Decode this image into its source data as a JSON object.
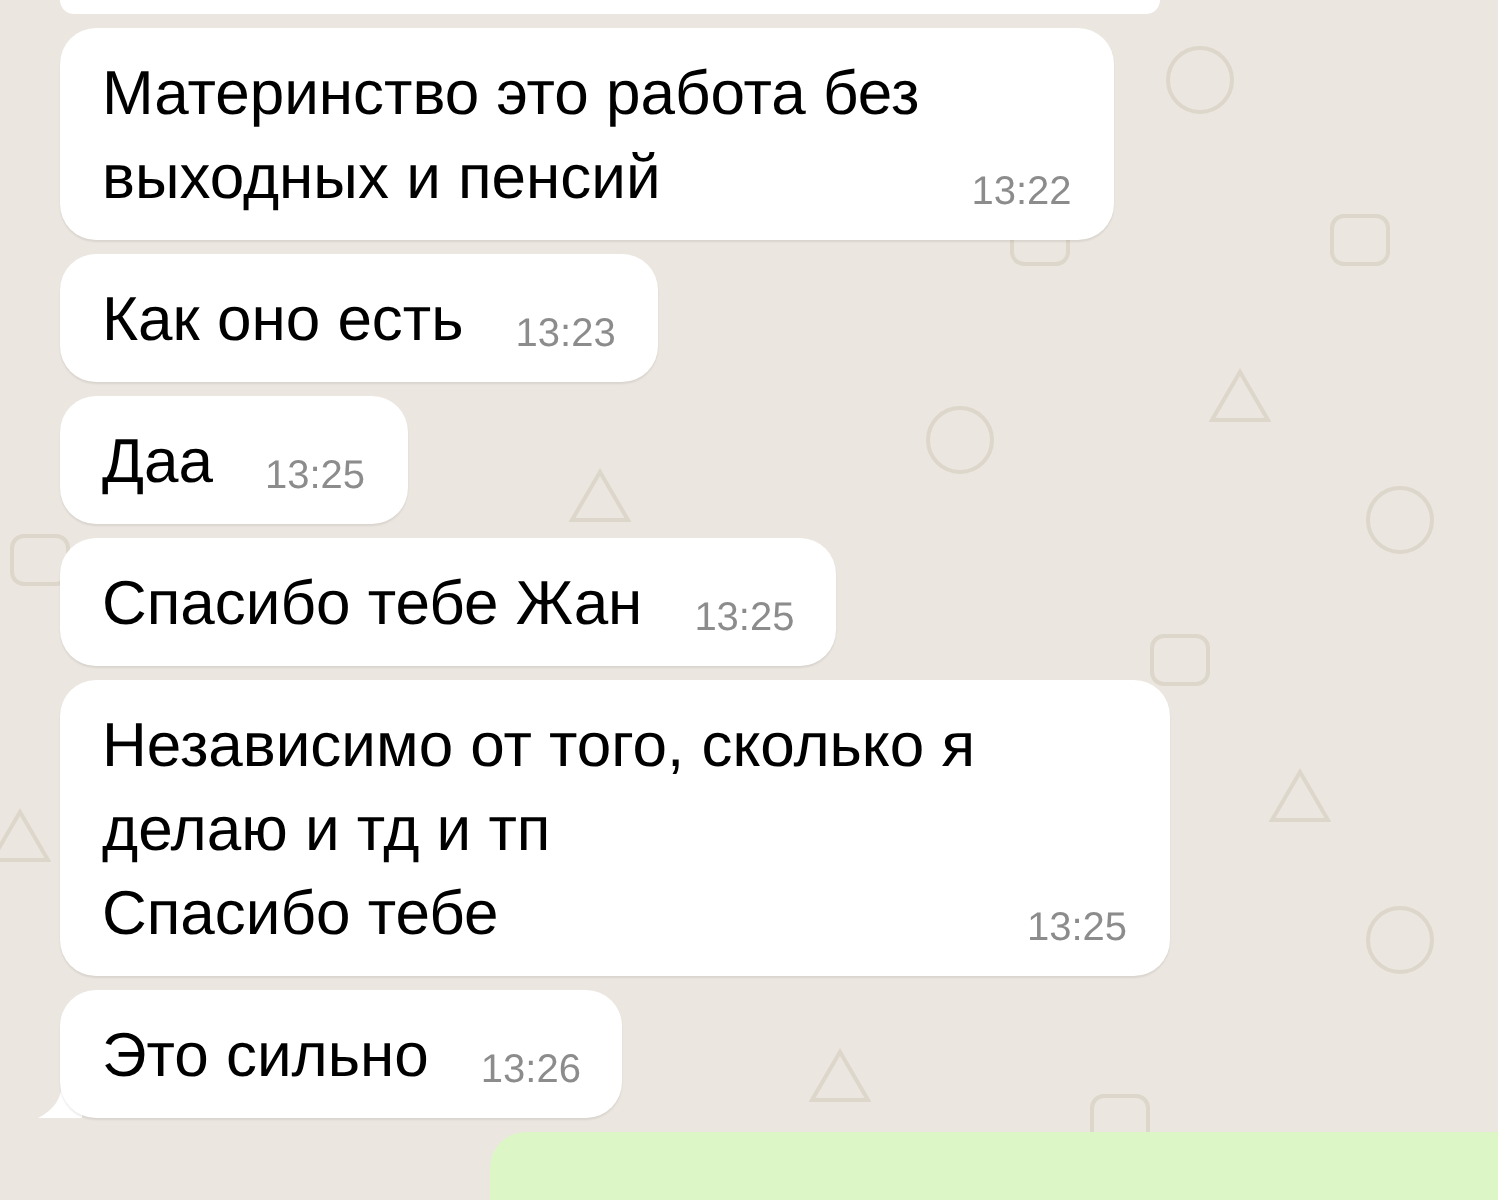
{
  "top_edge_bubble": {
    "outgoing": false
  },
  "messages": [
    {
      "text": "Материнство это работа без\nвыходных и пенсий",
      "time": "13:22",
      "tail": false
    },
    {
      "text": "Как оно есть",
      "time": "13:23",
      "tail": false
    },
    {
      "text": "Даа",
      "time": "13:25",
      "tail": false
    },
    {
      "text": "Спасибо тебе Жан",
      "time": "13:25",
      "tail": false
    },
    {
      "text": "Независимо от того, сколько я\nделаю и тд и тп\nСпасибо тебе",
      "time": "13:25",
      "tail": false
    },
    {
      "text": "Это сильно",
      "time": "13:26",
      "tail": true
    }
  ],
  "bottom_edge_bubble": {
    "outgoing": true
  }
}
